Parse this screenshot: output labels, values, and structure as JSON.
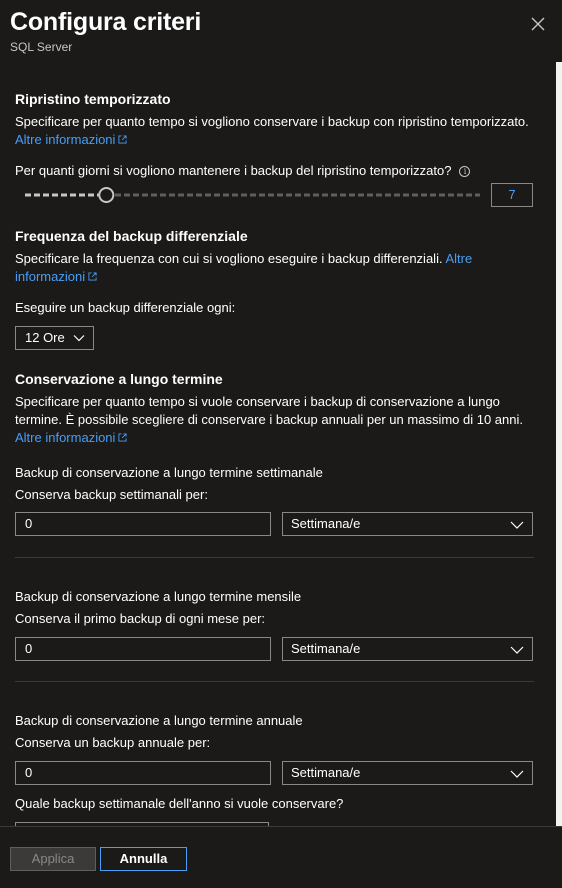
{
  "header": {
    "title": "Configura criteri",
    "subtitle": "SQL Server"
  },
  "pitr": {
    "title": "Ripristino temporizzato",
    "description": "Specificare per quanto tempo si vogliono conservare i backup con ripristino temporizzato.",
    "more_info": "Altre informazioni",
    "question": "Per quanti giorni si vogliono mantenere i backup del ripristino temporizzato?",
    "slider_value": "7",
    "slider_fraction": 0.167
  },
  "diff": {
    "title": "Frequenza del backup differenziale",
    "description": "Specificare la frequenza con cui si vogliono eseguire i backup differenziali.",
    "more_info_1": "Altre",
    "more_info_2": "informazioni",
    "label": "Eseguire un backup differenziale ogni:",
    "selected": "12 Ore"
  },
  "ltr": {
    "title": "Conservazione a lungo termine",
    "description_line1": "Specificare per quanto tempo si vuole conservare i backup di conservazione a lungo",
    "description_line2": "termine. È possibile scegliere di conservare i backup annuali per un massimo di 10 anni.",
    "more_info": "Altre informazioni",
    "weekly": {
      "heading": "Backup di conservazione a lungo termine settimanale",
      "label": "Conserva backup settimanali per:",
      "value": "0",
      "unit": "Settimana/e"
    },
    "monthly": {
      "heading": "Backup di conservazione a lungo termine mensile",
      "label": "Conserva il primo backup di ogni mese per:",
      "value": "0",
      "unit": "Settimana/e"
    },
    "yearly": {
      "heading": "Backup di conservazione a lungo termine annuale",
      "label": "Conserva un backup annuale per:",
      "value": "0",
      "unit": "Settimana/e",
      "week_question": "Quale backup settimanale dell'anno si vuole conservare?"
    }
  },
  "footer": {
    "apply": "Applica",
    "cancel": "Annulla"
  },
  "colors": {
    "background": "#1b1a19",
    "link": "#479ef5",
    "border": "#8a8886"
  }
}
